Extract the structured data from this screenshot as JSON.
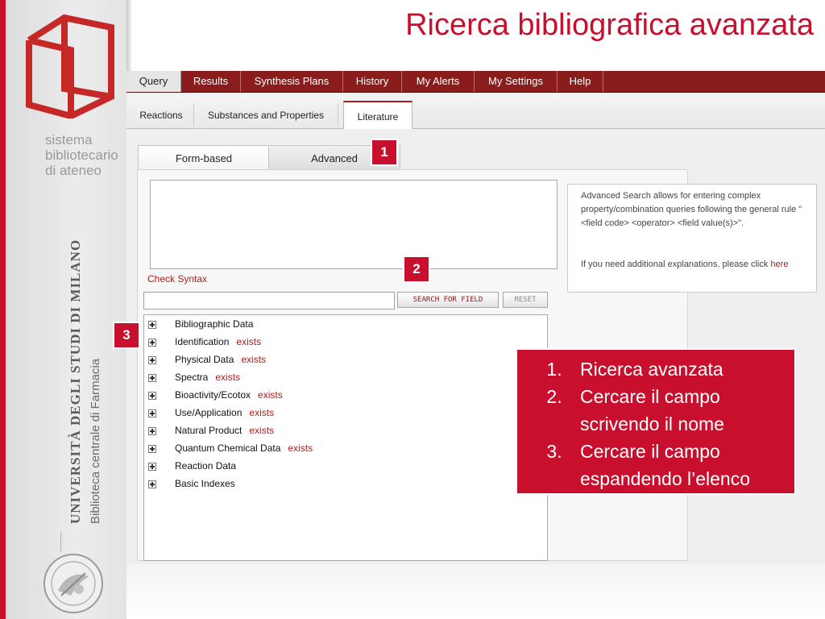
{
  "slide": {
    "title": "Ricerca bibliografica avanzata",
    "colors": {
      "accent": "#c8102e",
      "nav": "#8a1c1c"
    }
  },
  "branding": {
    "sistema_lines": [
      "sistema",
      "bibliotecario",
      "di ateneo"
    ],
    "university": "UNIVERSITÀ DEGLI STUDI DI MILANO",
    "library": "Biblioteca centrale di Farmacia",
    "logo_icon": "sistema-bibliotecario-logo",
    "seal_icon": "university-seal"
  },
  "app": {
    "nav": [
      "Query",
      "Results",
      "Synthesis Plans",
      "History",
      "My Alerts",
      "My Settings",
      "Help"
    ],
    "subtabs": [
      "Reactions",
      "Substances and Properties",
      "Literature"
    ],
    "form_tabs": [
      "Form-based",
      "Advanced"
    ],
    "query_value": "",
    "check_syntax": "Check Syntax",
    "field_search_value": "",
    "search_for_field": "SEARCH FOR FIELD",
    "reset": "RESET",
    "tree": [
      {
        "label": "Bibliographic Data",
        "tag": ""
      },
      {
        "label": "Identification",
        "tag": "exists"
      },
      {
        "label": "Physical Data",
        "tag": "exists"
      },
      {
        "label": "Spectra",
        "tag": "exists"
      },
      {
        "label": "Bioactivity/Ecotox",
        "tag": "exists"
      },
      {
        "label": "Use/Application",
        "tag": "exists"
      },
      {
        "label": "Natural Product",
        "tag": "exists"
      },
      {
        "label": "Quantum Chemical Data",
        "tag": "exists"
      },
      {
        "label": "Reaction Data",
        "tag": ""
      },
      {
        "label": "Basic Indexes",
        "tag": ""
      }
    ],
    "help_text": "Advanced Search allows for entering complex property/combination queries following the general rule \"<field code> <operator> <field value(s)>\".",
    "help_more": "If you need additional explanations, please click",
    "help_link": "here"
  },
  "badges": [
    "1",
    "2",
    "3"
  ],
  "callout": [
    "Ricerca avanzata",
    "Cercare il campo scrivendo il nome",
    "Cercare il campo espandendo l’elenco"
  ]
}
